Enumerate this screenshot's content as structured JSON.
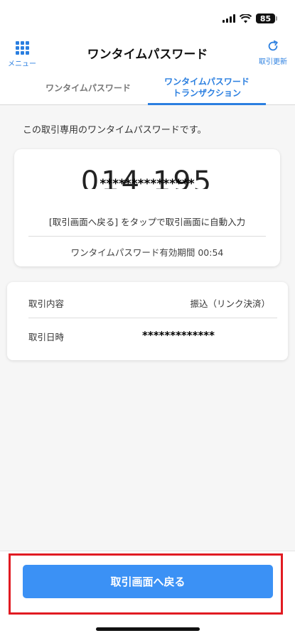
{
  "status_bar": {
    "battery": "85"
  },
  "nav": {
    "menu_label": "メニュー",
    "title": "ワンタイムパスワード",
    "refresh_label": "取引更新"
  },
  "tabs": [
    {
      "label": "ワンタイムパスワード",
      "active": false
    },
    {
      "label": "ワンタイムパスワード\nトランザクション",
      "active": true
    }
  ],
  "intro_text": "この取引専用のワンタイムパスワードです。",
  "otp": {
    "code_partial": "014 195",
    "masked": "***************",
    "hint": "[取引画面へ戻る] をタップで取引画面に自動入力",
    "expiry": "ワンタイムパスワード有効期間 00:54"
  },
  "details": {
    "rows": [
      {
        "label": "取引内容",
        "value": "振込（リンク決済）"
      },
      {
        "label": "取引日時",
        "value": "*************"
      }
    ]
  },
  "return_button": "取引画面へ戻る",
  "colors": {
    "accent": "#2b7fe0",
    "button": "#3b91f5",
    "highlight": "#e11b22"
  }
}
